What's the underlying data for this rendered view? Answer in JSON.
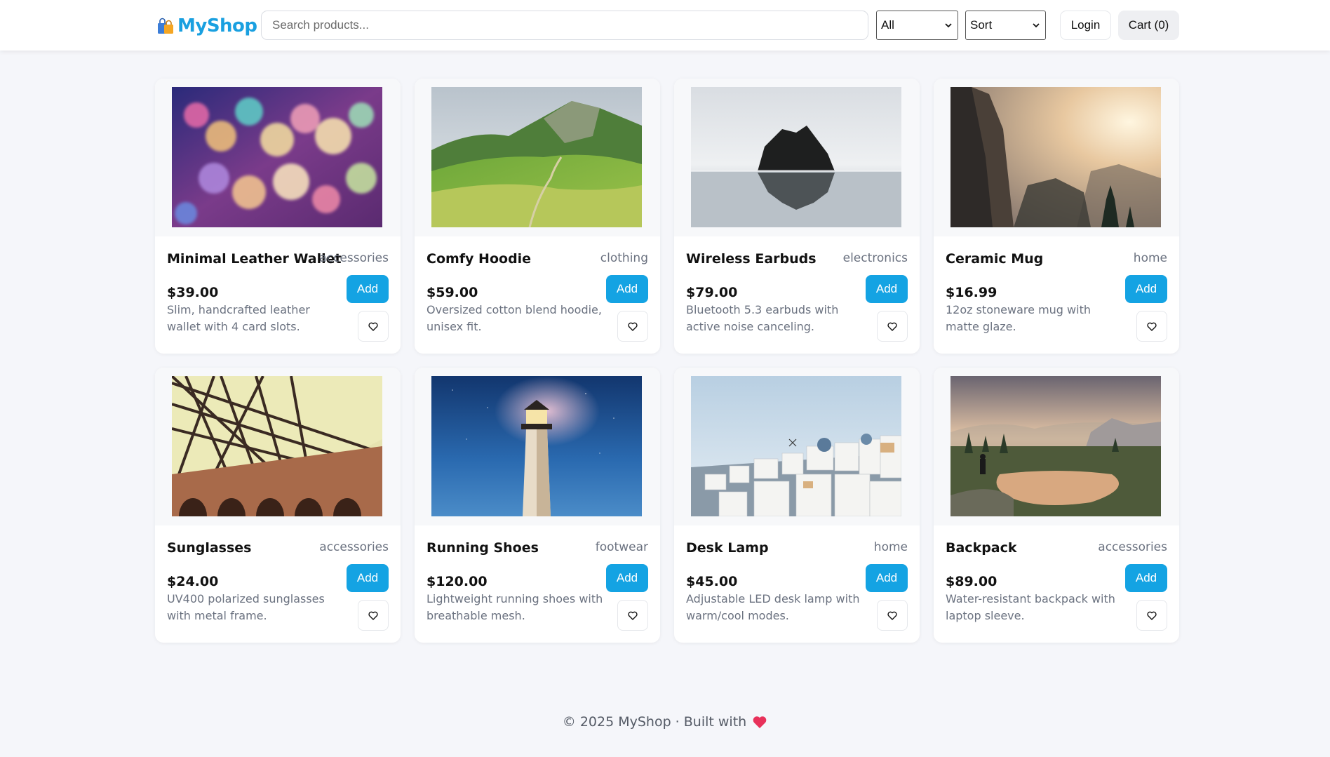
{
  "app": {
    "brand": "MyShop",
    "brand_color": "#1aa0e0",
    "logo_icon": "shopping-bags-icon"
  },
  "header": {
    "search_placeholder": "Search products...",
    "category_select": "All",
    "sort_select": "Sort",
    "login_label": "Login",
    "cart_label": "Cart (0)"
  },
  "products": [
    {
      "name": "Minimal Leather Wallet",
      "category": "accessories",
      "price": "$39.00",
      "description": "Slim, handcrafted leather wallet with 4 card slots.",
      "add_label": "Add",
      "image": "bokeh-lights-photo"
    },
    {
      "name": "Comfy Hoodie",
      "category": "clothing",
      "price": "$59.00",
      "description": "Oversized cotton blend hoodie, unisex fit.",
      "add_label": "Add",
      "image": "green-mountain-photo"
    },
    {
      "name": "Wireless Earbuds",
      "category": "electronics",
      "price": "$79.00",
      "description": "Bluetooth 5.3 earbuds with active noise canceling.",
      "add_label": "Add",
      "image": "sea-rock-photo"
    },
    {
      "name": "Ceramic Mug",
      "category": "home",
      "price": "$16.99",
      "description": "12oz stoneware mug with matte glaze.",
      "add_label": "Add",
      "image": "sunlit-cliffs-photo"
    },
    {
      "name": "Sunglasses",
      "category": "accessories",
      "price": "$24.00",
      "description": "UV400 polarized sunglasses with metal frame.",
      "add_label": "Add",
      "image": "steel-bridge-photo"
    },
    {
      "name": "Running Shoes",
      "category": "footwear",
      "price": "$120.00",
      "description": "Lightweight running shoes with breathable mesh.",
      "add_label": "Add",
      "image": "lighthouse-photo"
    },
    {
      "name": "Desk Lamp",
      "category": "home",
      "price": "$45.00",
      "description": "Adjustable LED desk lamp with warm/cool modes.",
      "add_label": "Add",
      "image": "white-village-photo"
    },
    {
      "name": "Backpack",
      "category": "accessories",
      "price": "$89.00",
      "description": "Water-resistant backpack with laptop sleeve.",
      "add_label": "Add",
      "image": "mountain-lake-photo"
    }
  ],
  "footer": {
    "text": "© 2025 MyShop · Built with",
    "heart_icon": "heart-icon",
    "heart_color": "#e8315a"
  },
  "colors": {
    "accent": "#14a3e3",
    "background": "#f5f6fa"
  }
}
